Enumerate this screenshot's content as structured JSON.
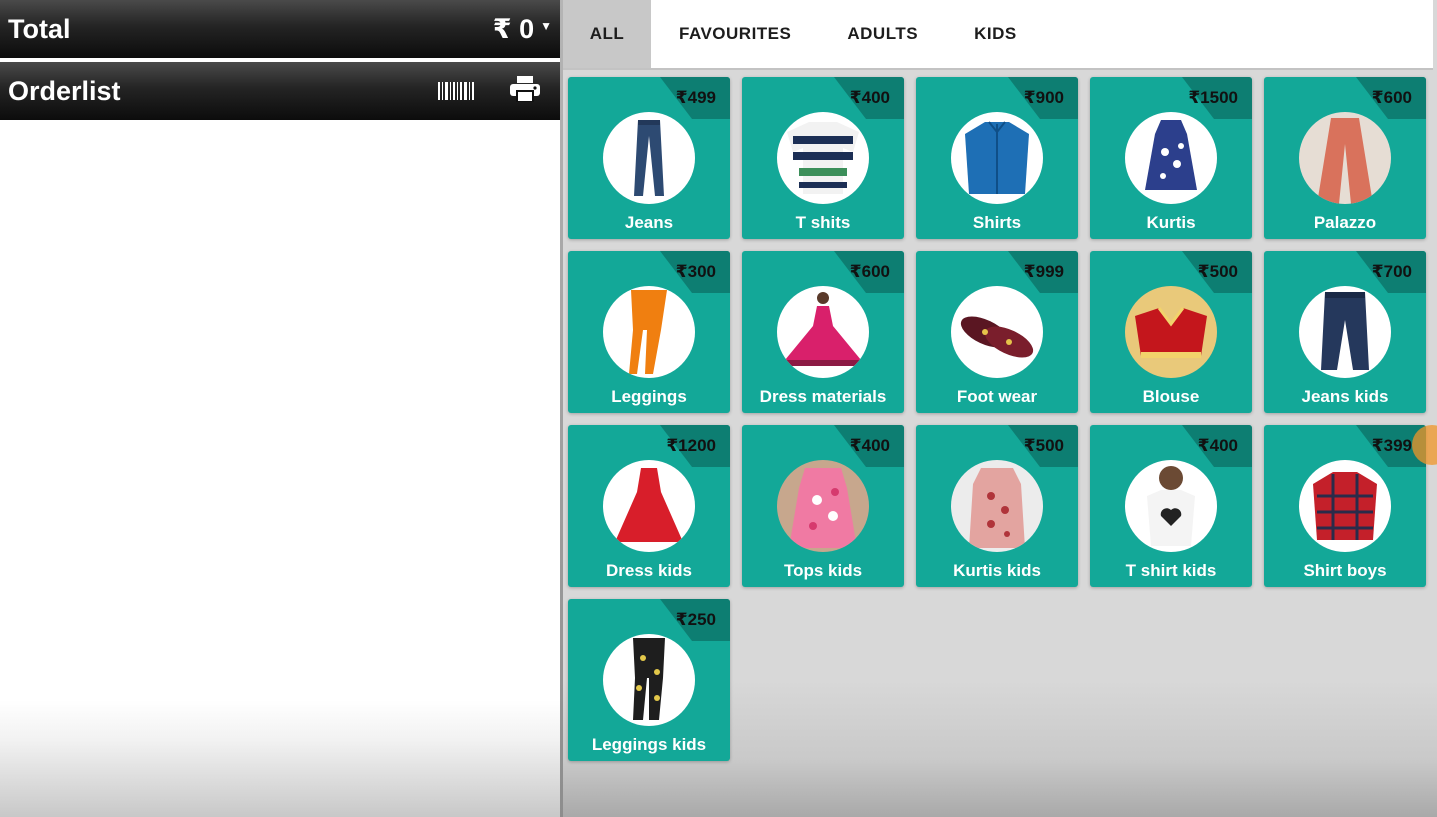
{
  "total": {
    "label": "Total",
    "value": "₹ 0"
  },
  "orderlist": {
    "label": "Orderlist",
    "icons": [
      "barcode-icon",
      "printer-icon"
    ]
  },
  "tabs": [
    {
      "label": "ALL",
      "active": true
    },
    {
      "label": "FAVOURITES",
      "active": false
    },
    {
      "label": "ADULTS",
      "active": false
    },
    {
      "label": "KIDS",
      "active": false
    }
  ],
  "products": [
    {
      "name": "Jeans",
      "price": "₹499",
      "image": "jeans"
    },
    {
      "name": "T shits",
      "price": "₹400",
      "image": "tshirt-stripes"
    },
    {
      "name": "Shirts",
      "price": "₹900",
      "image": "shirt-blue"
    },
    {
      "name": "Kurtis",
      "price": "₹1500",
      "image": "kurti"
    },
    {
      "name": "Palazzo",
      "price": "₹600",
      "image": "palazzo"
    },
    {
      "name": "Leggings",
      "price": "₹300",
      "image": "leggings"
    },
    {
      "name": "Dress materials",
      "price": "₹600",
      "image": "dress-material"
    },
    {
      "name": "Foot wear",
      "price": "₹999",
      "image": "footwear"
    },
    {
      "name": "Blouse",
      "price": "₹500",
      "image": "blouse"
    },
    {
      "name": "Jeans kids",
      "price": "₹700",
      "image": "jeans-kids"
    },
    {
      "name": "Dress kids",
      "price": "₹1200",
      "image": "dress-kids"
    },
    {
      "name": "Tops kids",
      "price": "₹400",
      "image": "tops-kids"
    },
    {
      "name": "Kurtis kids",
      "price": "₹500",
      "image": "kurtis-kids"
    },
    {
      "name": "T shirt kids",
      "price": "₹400",
      "image": "tshirt-kids"
    },
    {
      "name": "Shirt boys",
      "price": "₹399",
      "image": "shirt-boys"
    },
    {
      "name": "Leggings kids",
      "price": "₹250",
      "image": "leggings-kids"
    }
  ],
  "colors": {
    "card": "#13a898",
    "price_tag": "#0d7e72",
    "header_bar": "#1a1a1a"
  }
}
